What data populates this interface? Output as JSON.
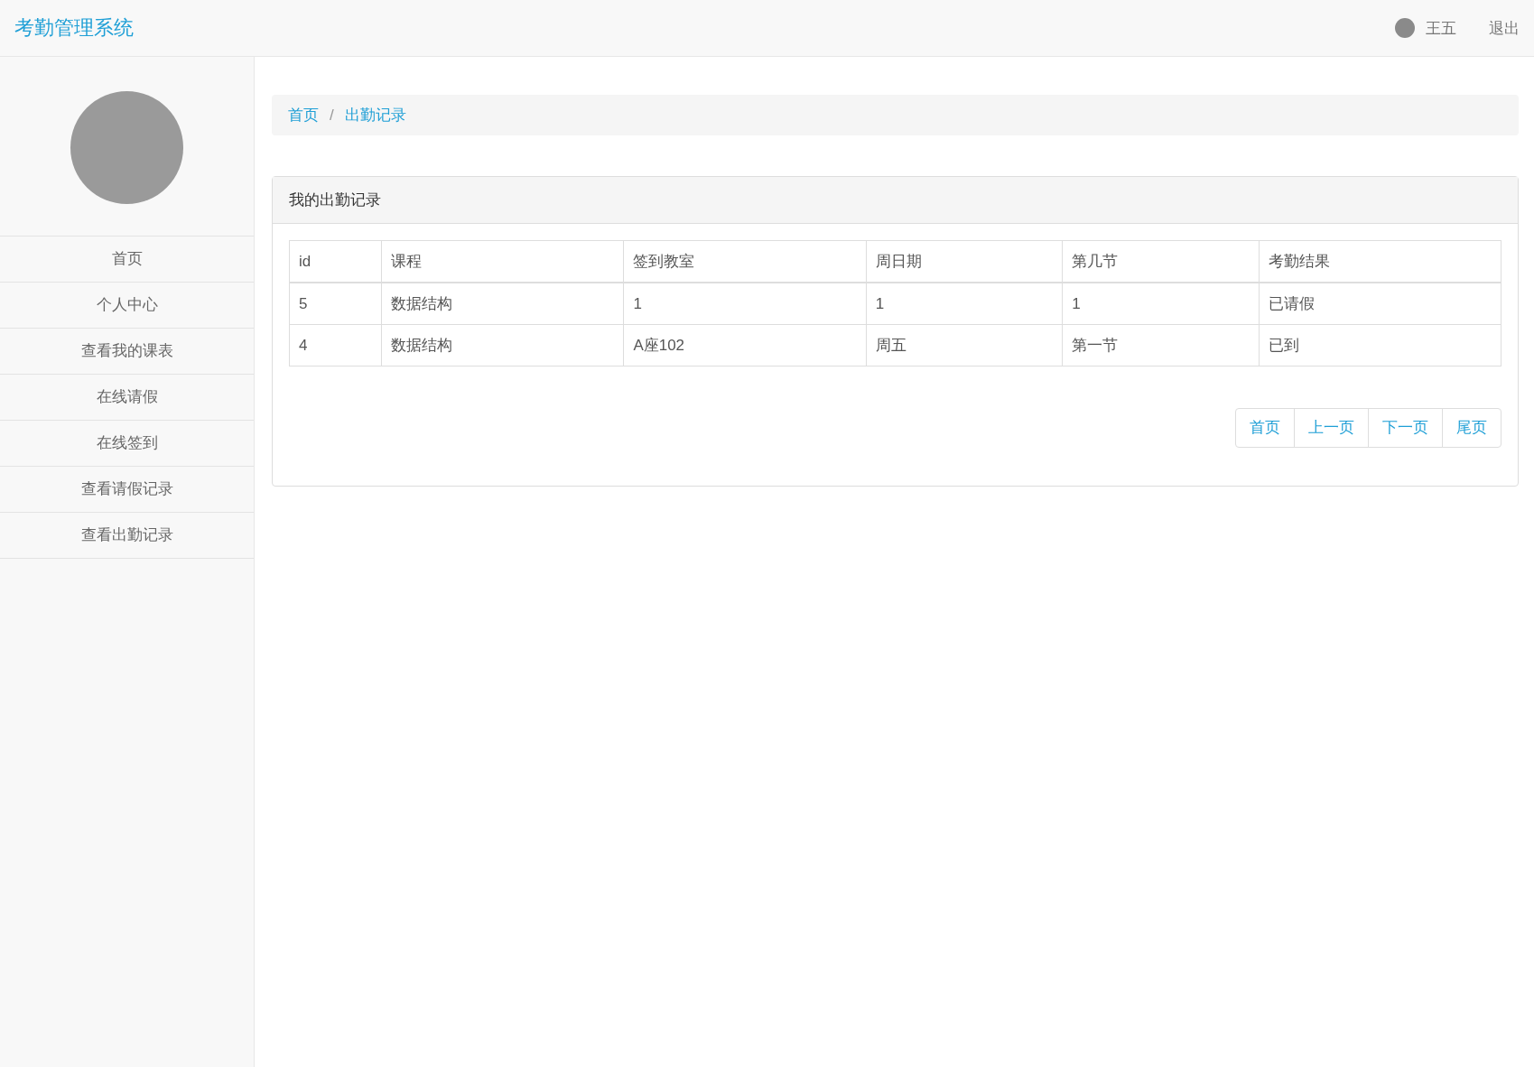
{
  "navbar": {
    "brand": "考勤管理系统",
    "user": "王五",
    "logout": "退出"
  },
  "sidebar": {
    "items": [
      {
        "label": "首页"
      },
      {
        "label": "个人中心"
      },
      {
        "label": "查看我的课表"
      },
      {
        "label": "在线请假"
      },
      {
        "label": "在线签到"
      },
      {
        "label": "查看请假记录"
      },
      {
        "label": "查看出勤记录"
      }
    ]
  },
  "breadcrumb": {
    "separator": "/",
    "items": [
      "首页",
      "出勤记录"
    ]
  },
  "panel": {
    "title": "我的出勤记录",
    "table": {
      "columns": [
        "id",
        "课程",
        "签到教室",
        "周日期",
        "第几节",
        "考勤结果"
      ],
      "rows": [
        [
          "5",
          "数据结构",
          "1",
          "1",
          "1",
          "已请假"
        ],
        [
          "4",
          "数据结构",
          "A座102",
          "周五",
          "第一节",
          "已到"
        ]
      ]
    },
    "pagination": [
      "首页",
      "上一页",
      "下一页",
      "尾页"
    ]
  }
}
